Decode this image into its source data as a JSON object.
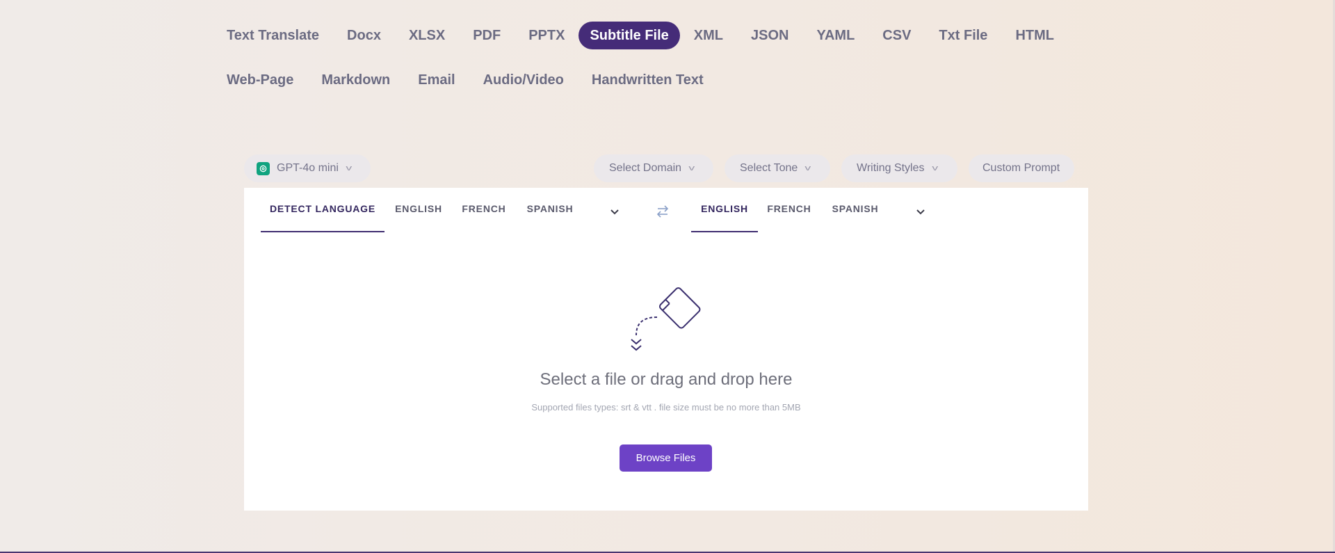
{
  "tabs": {
    "row1": [
      {
        "label": "Text Translate",
        "active": false
      },
      {
        "label": "Docx",
        "active": false
      },
      {
        "label": "XLSX",
        "active": false
      },
      {
        "label": "PDF",
        "active": false
      },
      {
        "label": "PPTX",
        "active": false
      },
      {
        "label": "Subtitle File",
        "active": true
      },
      {
        "label": "XML",
        "active": false
      },
      {
        "label": "JSON",
        "active": false
      },
      {
        "label": "YAML",
        "active": false
      },
      {
        "label": "CSV",
        "active": false
      },
      {
        "label": "Txt File",
        "active": false
      },
      {
        "label": "HTML",
        "active": false
      }
    ],
    "row2": [
      {
        "label": "Web-Page",
        "active": false
      },
      {
        "label": "Markdown",
        "active": false
      },
      {
        "label": "Email",
        "active": false
      },
      {
        "label": "Audio/Video",
        "active": false
      },
      {
        "label": "Handwritten Text",
        "active": false
      }
    ]
  },
  "toolbar": {
    "model": "GPT-4o mini",
    "domain": "Select Domain",
    "tone": "Select Tone",
    "styles": "Writing Styles",
    "custom_prompt": "Custom Prompt"
  },
  "source_langs": [
    "DETECT LANGUAGE",
    "ENGLISH",
    "FRENCH",
    "SPANISH"
  ],
  "target_langs": [
    "ENGLISH",
    "FRENCH",
    "SPANISH"
  ],
  "upload": {
    "title": "Select a file or drag and drop here",
    "subtitle": "Supported files types: srt & vtt . file size must be no more than 5MB",
    "button": "Browse Files"
  },
  "colors": {
    "accent": "#452c78",
    "button": "#6d42c6",
    "model_logo": "#10a37f"
  }
}
